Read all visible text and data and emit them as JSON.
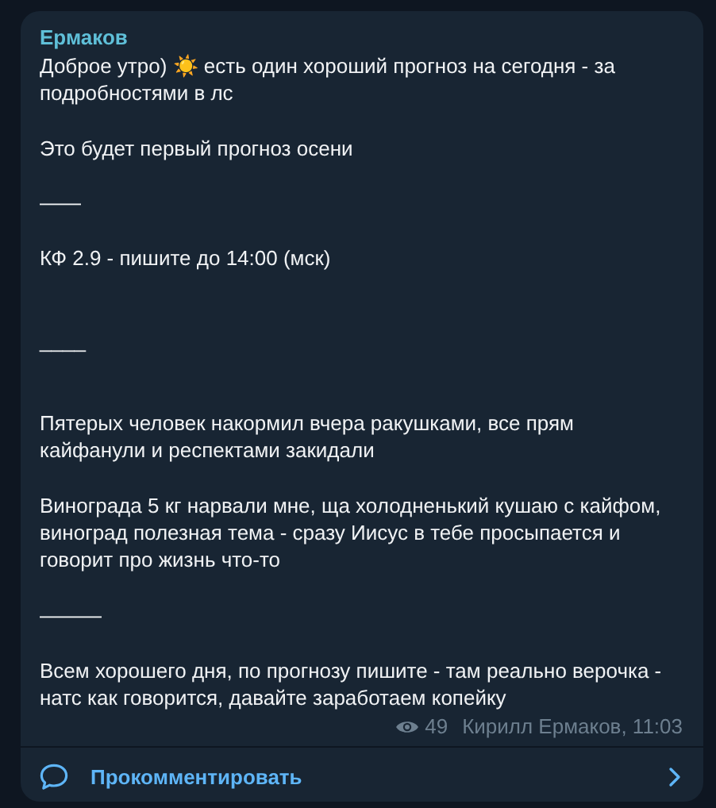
{
  "message": {
    "author": "Ермаков",
    "intro": "Доброе утро) ☀️ есть один хороший прогноз на сегодня - за подробностями в лс",
    "paragraphs": [
      "Это будет первый прогноз осени",
      "——",
      "КФ 2.9 - пишите до 14:00 (мск)",
      "\n____",
      "\nПятерых человек накормил вчера ракушками, все прям кайфанули и респектами закидали",
      "Винограда 5 кг нарвали мне, ща холодненький кушаю с кайфом, виноград полезная тема - сразу Иисус в тебе просыпается и говорит про жизнь что-то",
      "———",
      "Всем хорошего дня, по прогнозу пишите - там реально верочка - натс как говорится, давайте заработаем копейку"
    ],
    "views": "49",
    "signature": "Кирилл Ермаков, 11:03"
  },
  "comment_button": {
    "label": "Прокомментировать"
  }
}
